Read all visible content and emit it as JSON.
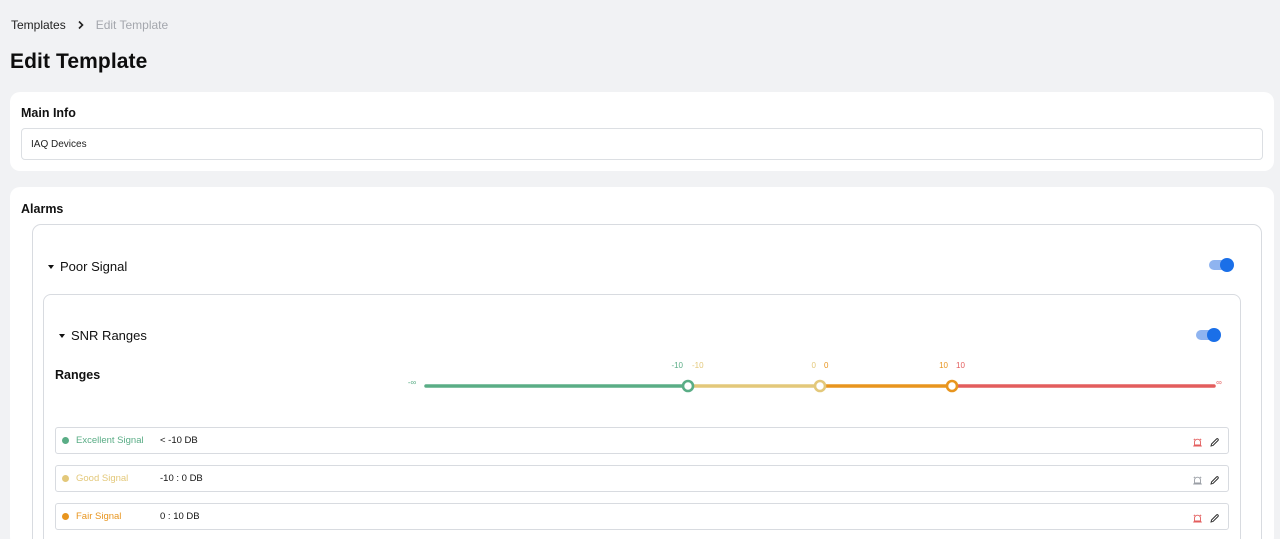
{
  "breadcrumb": {
    "parent": "Templates",
    "current": "Edit Template"
  },
  "page": {
    "title": "Edit Template"
  },
  "main_info": {
    "title": "Main Info",
    "name_value": "IAQ Devices"
  },
  "alarms": {
    "title": "Alarms",
    "alarm": {
      "label": "Poor Signal",
      "enabled": true,
      "snr": {
        "label": "SNR Ranges",
        "enabled": true,
        "ranges_label": "Ranges",
        "slider": {
          "min_label": "-∞",
          "max_label": "∞",
          "thresholds": [
            {
              "left": "-10",
              "right": "-10"
            },
            {
              "left": "0",
              "right": "0"
            },
            {
              "left": "10",
              "right": "10"
            }
          ],
          "segment_colors": [
            "#5aad86",
            "#e3c87a",
            "#e8951e",
            "#e35d5d"
          ]
        },
        "rows": [
          {
            "name": "Excellent Signal",
            "value": "< -10 DB",
            "color": "#5aad86",
            "alarm_active": true
          },
          {
            "name": "Good Signal",
            "value": "-10 : 0 DB",
            "color": "#e3c87a",
            "alarm_active": false
          },
          {
            "name": "Fair Signal",
            "value": "0 : 10 DB",
            "color": "#e8951e",
            "alarm_active": true
          }
        ]
      }
    }
  },
  "icons": {
    "breadcrumb_separator": "chevron-right-icon",
    "expand": "caret-down-icon",
    "alarm": "alarm-bell-icon",
    "edit": "pencil-icon"
  },
  "colors": {
    "accent": "#1a6fe8",
    "alarm_active": "#e35d5d",
    "alarm_inactive": "#9a9ea5"
  }
}
